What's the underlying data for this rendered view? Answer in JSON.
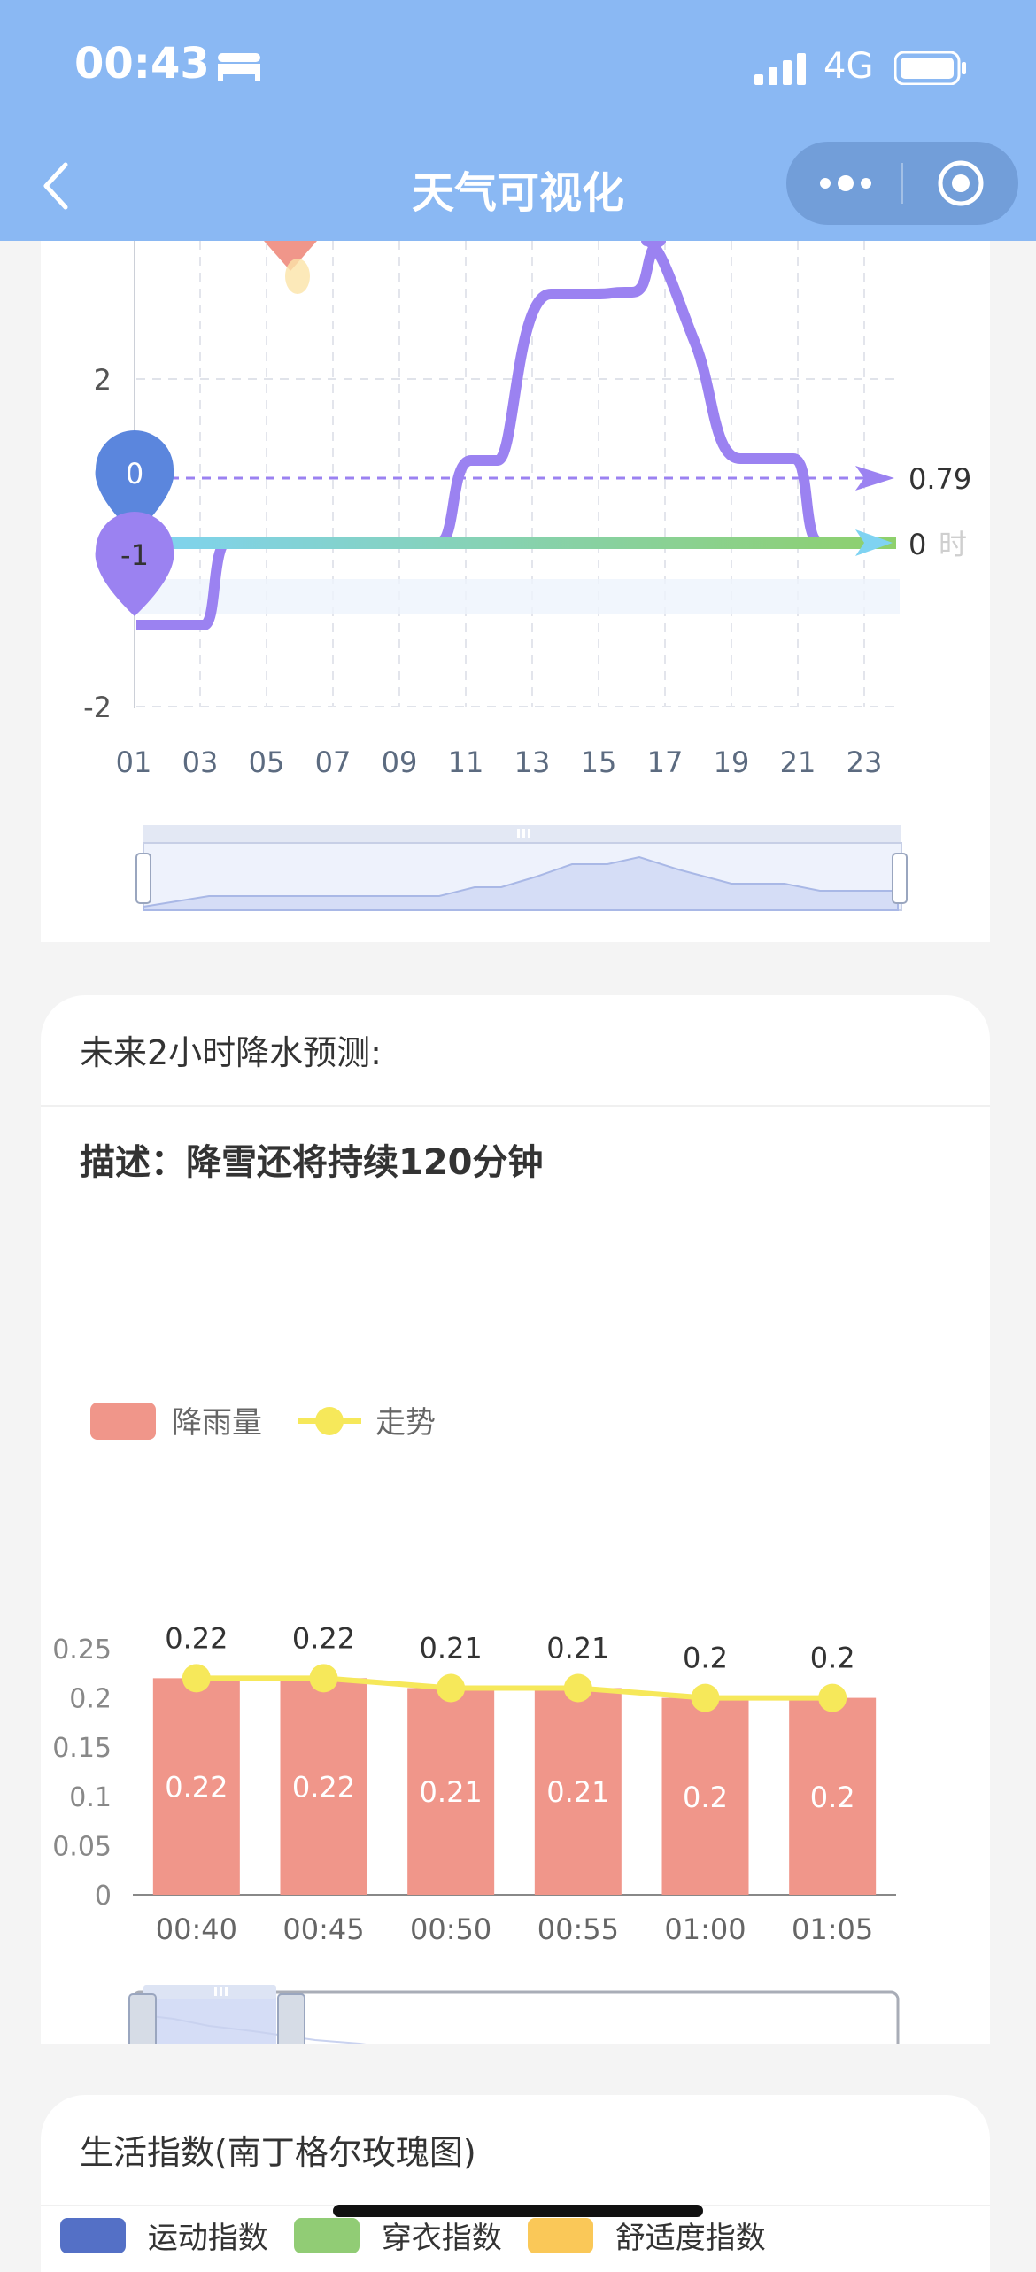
{
  "status": {
    "time": "00:43",
    "network": "4G"
  },
  "nav": {
    "title": "天气可视化"
  },
  "temp_chart": {
    "y_ticks": [
      "2",
      "-2"
    ],
    "x_ticks": [
      "01",
      "03",
      "05",
      "07",
      "09",
      "11",
      "13",
      "15",
      "17",
      "19",
      "21",
      "23"
    ],
    "marker_max": "0",
    "marker_min": "-1",
    "markline_avg": "0.79",
    "markline_zero": "0",
    "markline_zero_unit": "时"
  },
  "rain_card": {
    "title": "未来2小时降水预测:",
    "description": "描述：降雪还将持续120分钟",
    "legend": {
      "bar": "降雨量",
      "line": "走势"
    }
  },
  "chart_data": {
    "type": "bar",
    "categories": [
      "00:40",
      "00:45",
      "00:50",
      "00:55",
      "01:00",
      "01:05"
    ],
    "series": [
      {
        "name": "降雨量",
        "type": "bar",
        "values": [
          0.22,
          0.22,
          0.21,
          0.21,
          0.2,
          0.2
        ]
      },
      {
        "name": "走势",
        "type": "line",
        "values": [
          0.22,
          0.22,
          0.21,
          0.21,
          0.2,
          0.2
        ]
      }
    ],
    "value_labels_top": [
      "0.22",
      "0.22",
      "0.21",
      "0.21",
      "0.2",
      "0.2"
    ],
    "value_labels_inside": [
      "0.22",
      "0.22",
      "0.21",
      "0.21",
      "0.2",
      "0.2"
    ],
    "y_ticks": [
      "0",
      "0.05",
      "0.1",
      "0.15",
      "0.2",
      "0.25"
    ],
    "ylim": [
      0,
      0.25
    ],
    "colors": {
      "bar": "#f0968a",
      "line": "#f6e85a"
    }
  },
  "life_card": {
    "title": "生活指数(南丁格尔玫瑰图)",
    "legend": [
      {
        "label": "运动指数",
        "color": "#5470c6"
      },
      {
        "label": "穿衣指数",
        "color": "#91cc75"
      },
      {
        "label": "舒适度指数",
        "color": "#fac858"
      }
    ]
  }
}
